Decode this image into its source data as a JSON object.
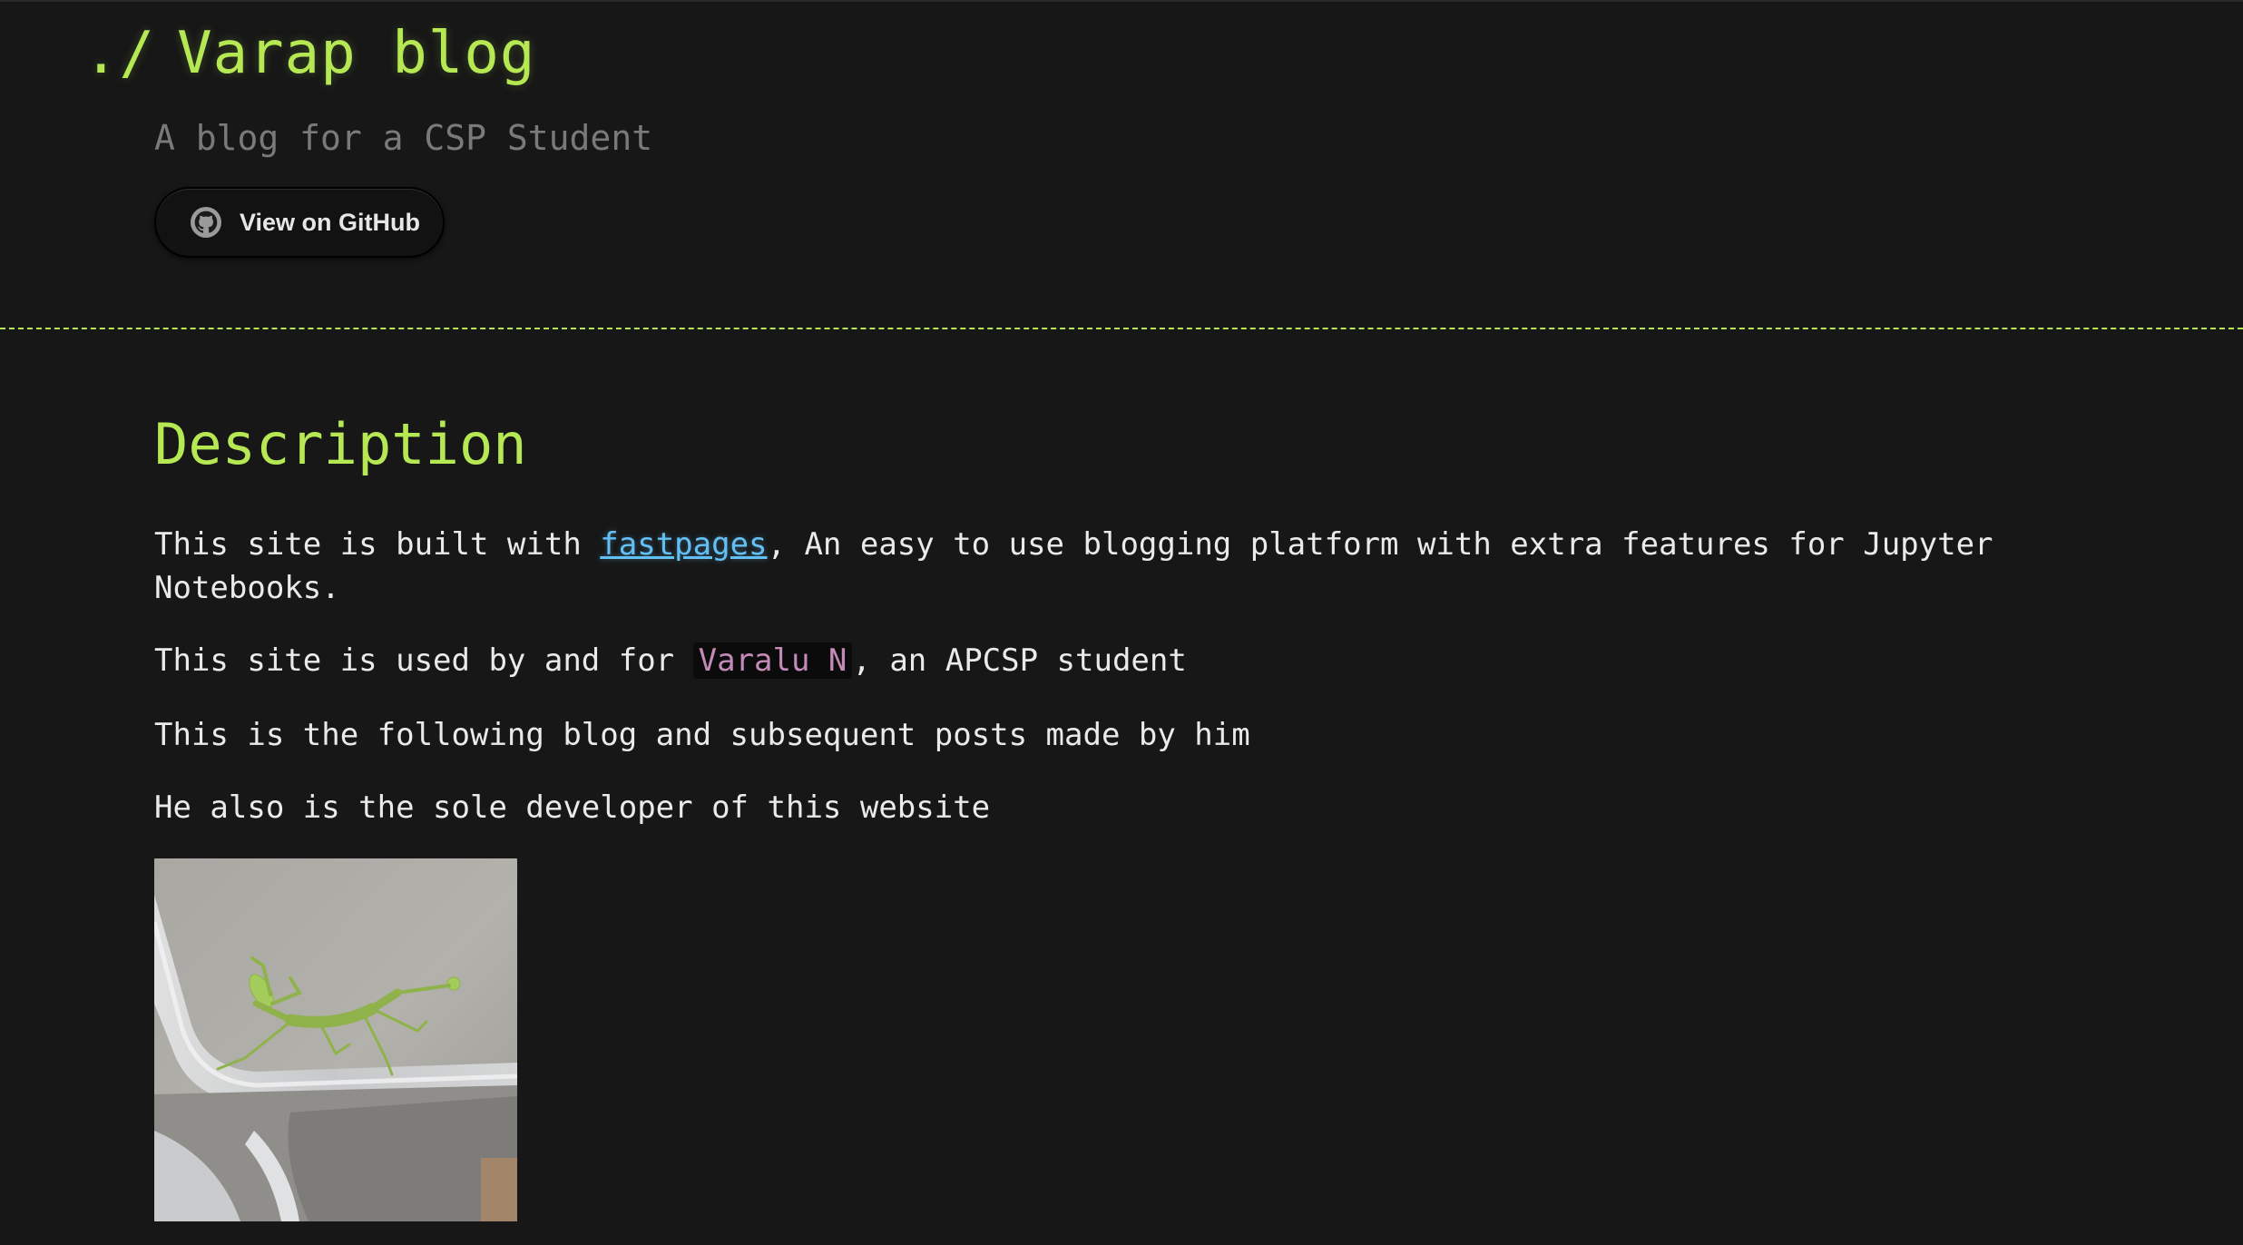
{
  "header": {
    "prompt": "./",
    "title": "Varap blog",
    "subtitle": "A blog for a CSP Student",
    "github_button_label": "View on GitHub"
  },
  "main": {
    "heading": "Description",
    "p1_before": "This site is built with ",
    "p1_link": "fastpages",
    "p1_after": ", An easy to use blogging platform with extra features for Jupyter Notebooks.",
    "p2_before": "This site is used by and for ",
    "p2_code": "Varalu N",
    "p2_after": ", an APCSP student",
    "p3": "This is the following blog and subsequent posts made by him",
    "p4": "He also is the sole developer of this website"
  },
  "colors": {
    "background": "#171717",
    "accent": "#b5e853",
    "link": "#63c0f5",
    "subtitle": "#7a7a7a",
    "code_text": "#c48ab8"
  },
  "icons": {
    "github": "github-icon"
  }
}
